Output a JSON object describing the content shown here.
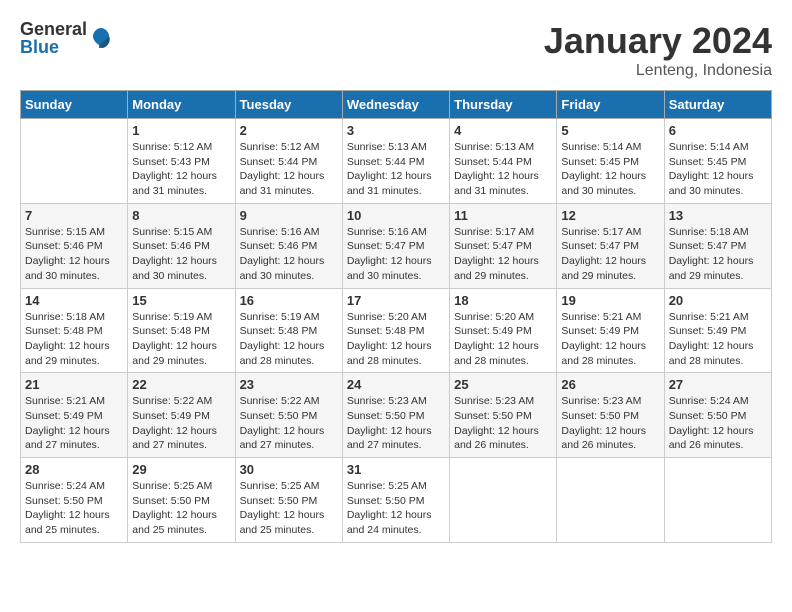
{
  "header": {
    "logo_general": "General",
    "logo_blue": "Blue",
    "month_year": "January 2024",
    "location": "Lenteng, Indonesia"
  },
  "days_of_week": [
    "Sunday",
    "Monday",
    "Tuesday",
    "Wednesday",
    "Thursday",
    "Friday",
    "Saturday"
  ],
  "weeks": [
    [
      {
        "day": "",
        "info": ""
      },
      {
        "day": "1",
        "info": "Sunrise: 5:12 AM\nSunset: 5:43 PM\nDaylight: 12 hours\nand 31 minutes."
      },
      {
        "day": "2",
        "info": "Sunrise: 5:12 AM\nSunset: 5:44 PM\nDaylight: 12 hours\nand 31 minutes."
      },
      {
        "day": "3",
        "info": "Sunrise: 5:13 AM\nSunset: 5:44 PM\nDaylight: 12 hours\nand 31 minutes."
      },
      {
        "day": "4",
        "info": "Sunrise: 5:13 AM\nSunset: 5:44 PM\nDaylight: 12 hours\nand 31 minutes."
      },
      {
        "day": "5",
        "info": "Sunrise: 5:14 AM\nSunset: 5:45 PM\nDaylight: 12 hours\nand 30 minutes."
      },
      {
        "day": "6",
        "info": "Sunrise: 5:14 AM\nSunset: 5:45 PM\nDaylight: 12 hours\nand 30 minutes."
      }
    ],
    [
      {
        "day": "7",
        "info": "Sunrise: 5:15 AM\nSunset: 5:46 PM\nDaylight: 12 hours\nand 30 minutes."
      },
      {
        "day": "8",
        "info": "Sunrise: 5:15 AM\nSunset: 5:46 PM\nDaylight: 12 hours\nand 30 minutes."
      },
      {
        "day": "9",
        "info": "Sunrise: 5:16 AM\nSunset: 5:46 PM\nDaylight: 12 hours\nand 30 minutes."
      },
      {
        "day": "10",
        "info": "Sunrise: 5:16 AM\nSunset: 5:47 PM\nDaylight: 12 hours\nand 30 minutes."
      },
      {
        "day": "11",
        "info": "Sunrise: 5:17 AM\nSunset: 5:47 PM\nDaylight: 12 hours\nand 29 minutes."
      },
      {
        "day": "12",
        "info": "Sunrise: 5:17 AM\nSunset: 5:47 PM\nDaylight: 12 hours\nand 29 minutes."
      },
      {
        "day": "13",
        "info": "Sunrise: 5:18 AM\nSunset: 5:47 PM\nDaylight: 12 hours\nand 29 minutes."
      }
    ],
    [
      {
        "day": "14",
        "info": "Sunrise: 5:18 AM\nSunset: 5:48 PM\nDaylight: 12 hours\nand 29 minutes."
      },
      {
        "day": "15",
        "info": "Sunrise: 5:19 AM\nSunset: 5:48 PM\nDaylight: 12 hours\nand 29 minutes."
      },
      {
        "day": "16",
        "info": "Sunrise: 5:19 AM\nSunset: 5:48 PM\nDaylight: 12 hours\nand 28 minutes."
      },
      {
        "day": "17",
        "info": "Sunrise: 5:20 AM\nSunset: 5:48 PM\nDaylight: 12 hours\nand 28 minutes."
      },
      {
        "day": "18",
        "info": "Sunrise: 5:20 AM\nSunset: 5:49 PM\nDaylight: 12 hours\nand 28 minutes."
      },
      {
        "day": "19",
        "info": "Sunrise: 5:21 AM\nSunset: 5:49 PM\nDaylight: 12 hours\nand 28 minutes."
      },
      {
        "day": "20",
        "info": "Sunrise: 5:21 AM\nSunset: 5:49 PM\nDaylight: 12 hours\nand 28 minutes."
      }
    ],
    [
      {
        "day": "21",
        "info": "Sunrise: 5:21 AM\nSunset: 5:49 PM\nDaylight: 12 hours\nand 27 minutes."
      },
      {
        "day": "22",
        "info": "Sunrise: 5:22 AM\nSunset: 5:49 PM\nDaylight: 12 hours\nand 27 minutes."
      },
      {
        "day": "23",
        "info": "Sunrise: 5:22 AM\nSunset: 5:50 PM\nDaylight: 12 hours\nand 27 minutes."
      },
      {
        "day": "24",
        "info": "Sunrise: 5:23 AM\nSunset: 5:50 PM\nDaylight: 12 hours\nand 27 minutes."
      },
      {
        "day": "25",
        "info": "Sunrise: 5:23 AM\nSunset: 5:50 PM\nDaylight: 12 hours\nand 26 minutes."
      },
      {
        "day": "26",
        "info": "Sunrise: 5:23 AM\nSunset: 5:50 PM\nDaylight: 12 hours\nand 26 minutes."
      },
      {
        "day": "27",
        "info": "Sunrise: 5:24 AM\nSunset: 5:50 PM\nDaylight: 12 hours\nand 26 minutes."
      }
    ],
    [
      {
        "day": "28",
        "info": "Sunrise: 5:24 AM\nSunset: 5:50 PM\nDaylight: 12 hours\nand 25 minutes."
      },
      {
        "day": "29",
        "info": "Sunrise: 5:25 AM\nSunset: 5:50 PM\nDaylight: 12 hours\nand 25 minutes."
      },
      {
        "day": "30",
        "info": "Sunrise: 5:25 AM\nSunset: 5:50 PM\nDaylight: 12 hours\nand 25 minutes."
      },
      {
        "day": "31",
        "info": "Sunrise: 5:25 AM\nSunset: 5:50 PM\nDaylight: 12 hours\nand 24 minutes."
      },
      {
        "day": "",
        "info": ""
      },
      {
        "day": "",
        "info": ""
      },
      {
        "day": "",
        "info": ""
      }
    ]
  ]
}
